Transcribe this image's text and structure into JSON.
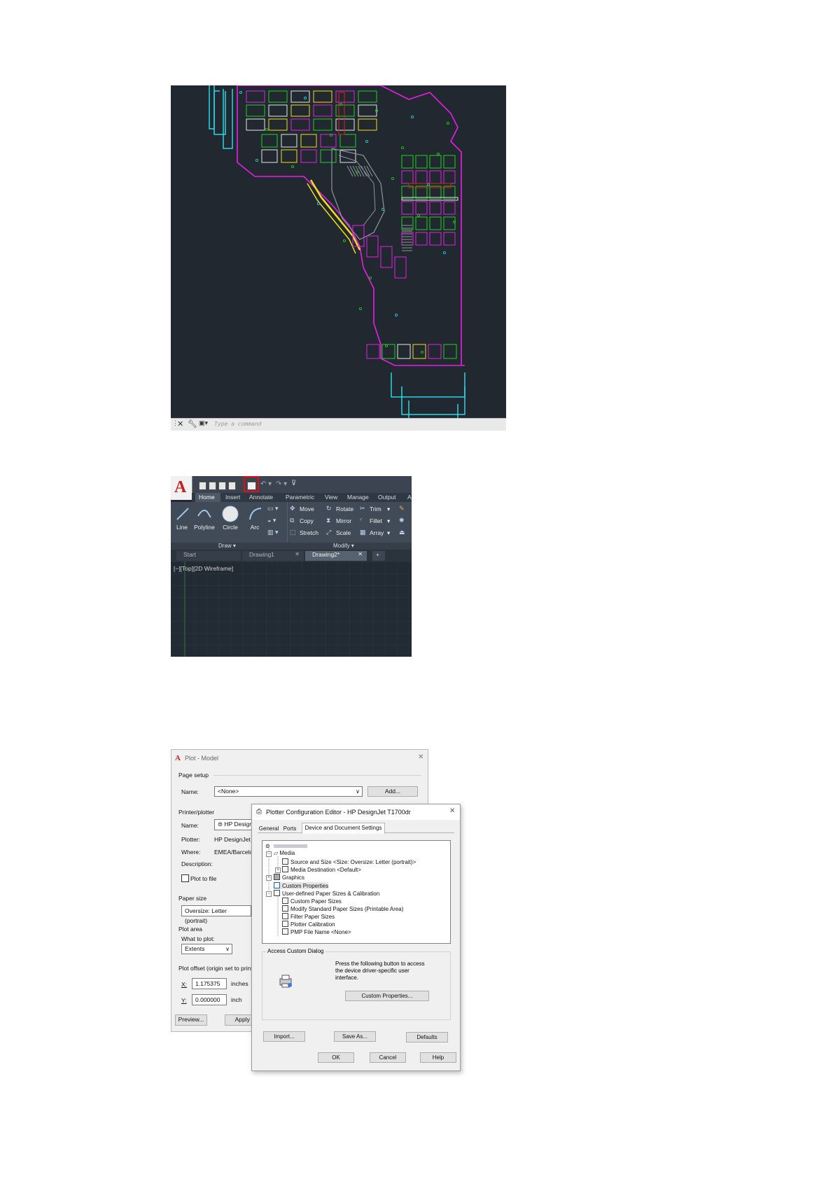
{
  "panel1": {
    "command_prompt": "Type a command",
    "colors": {
      "background": "#212830",
      "walls_cyan": "#27d8e6",
      "walls_magenta": "#e81ee8",
      "walls_yellow": "#f0e01c",
      "walls_green": "#1ed21e",
      "walls_gray": "#8f959c",
      "walls_red": "#e21c1c",
      "walls_white": "#e6e6e6"
    }
  },
  "panel2": {
    "ribbon_tabs": [
      "Home",
      "Insert",
      "Annotate",
      "Parametric",
      "View",
      "Manage",
      "Output"
    ],
    "draw_tools": [
      "Line",
      "Polyline",
      "Circle",
      "Arc"
    ],
    "modify_tools": [
      {
        "label": "Move",
        "icon": "move-icon"
      },
      {
        "label": "Rotate",
        "icon": "rotate-icon"
      },
      {
        "label": "Trim",
        "icon": "trim-icon"
      },
      {
        "label": "Copy",
        "icon": "copy-icon"
      },
      {
        "label": "Mirror",
        "icon": "mirror-icon"
      },
      {
        "label": "Fillet",
        "icon": "fillet-icon"
      },
      {
        "label": "Stretch",
        "icon": "stretch-icon"
      },
      {
        "label": "Scale",
        "icon": "scale-icon"
      },
      {
        "label": "Array",
        "icon": "array-icon"
      }
    ],
    "panel_titles": {
      "draw": "Draw",
      "modify": "Modify"
    },
    "doc_tabs": [
      "Start",
      "Drawing1",
      "Drawing2*"
    ],
    "viewport_label": "[−][Top][2D Wireframe]",
    "highlight_color": "#e01010"
  },
  "plot_dialog": {
    "title": "Plot - Model",
    "page_setup": {
      "group": "Page setup",
      "name_label": "Name:",
      "name_value": "<None>",
      "add_button": "Add..."
    },
    "printer": {
      "group": "Printer/plotter",
      "name_label": "Name:",
      "name_value": "HP Design",
      "plotter_label": "Plotter:",
      "plotter_value": "HP DesignJet T",
      "where_label": "Where:",
      "where_value": "EMEA/Barcelona",
      "description_label": "Description:",
      "plot_to_file": "Plot to file"
    },
    "paper_size": {
      "group": "Paper size",
      "value": "Oversize: Letter (portrait)"
    },
    "plot_area": {
      "group": "Plot area",
      "what_label": "What to plot:",
      "what_value": "Extents"
    },
    "plot_offset": {
      "group": "Plot offset (origin set to printa",
      "x_label": "X:",
      "x_value": "1.175375",
      "x_unit": "inches",
      "y_label": "Y:",
      "y_value": "0.000000",
      "y_unit": "inch"
    },
    "preview_button": "Preview...",
    "apply_button": "Apply to"
  },
  "config_dialog": {
    "title": "Plotter Configuration Editor - HP DesignJet T1700dr",
    "tabs": [
      "General",
      "Ports",
      "Device and Document Settings"
    ],
    "tree": [
      {
        "label": "Media"
      },
      {
        "label": "Source and Size <Size: Oversize: Letter (portrait)>"
      },
      {
        "label": "Media Destination <Default>"
      },
      {
        "label": "Graphics"
      },
      {
        "label": "Custom Properties"
      },
      {
        "label": "User-defined Paper Sizes & Calibration"
      },
      {
        "label": "Custom Paper Sizes"
      },
      {
        "label": "Modify Standard Paper Sizes (Printable Area)"
      },
      {
        "label": "Filter Paper Sizes"
      },
      {
        "label": "Plotter Calibration"
      },
      {
        "label": "PMP File Name <None>"
      }
    ],
    "access_group": "Access Custom Dialog",
    "access_text": "Press the following button to access the device driver-specific user interface.",
    "custom_properties_button": "Custom Properties...",
    "import_button": "Import...",
    "save_as_button": "Save As...",
    "defaults_button": "Defaults",
    "ok_button": "OK",
    "cancel_button": "Cancel",
    "help_button": "Help"
  }
}
